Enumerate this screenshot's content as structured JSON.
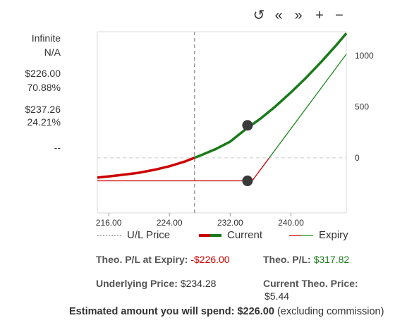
{
  "toolbar": {
    "reset_icon": "↺",
    "prev_icon": "«",
    "next_icon": "»",
    "zoom_in_icon": "+",
    "zoom_out_icon": "−"
  },
  "stats": {
    "max_profit": "Infinite",
    "max_profit_pct": "N/A",
    "max_loss": "$226.00",
    "max_loss_pct": "70.88%",
    "breakeven": "$237.26",
    "breakeven_pct": "24.21%",
    "other": "--"
  },
  "legend": {
    "ul_price": "U/L Price",
    "current": "Current",
    "expiry": "Expiry"
  },
  "colors": {
    "current_green": "#1a7a1a",
    "current_red": "#cc0000",
    "expiry_green": "#1f8a1f",
    "expiry_red": "#cc0000",
    "ul_line": "#888888",
    "point": "#3a3a3a"
  },
  "summary": {
    "theo_pl_expiry_label": "Theo. P/L at Expiry:",
    "theo_pl_expiry_value": "-$226.00",
    "theo_pl_label": "Theo. P/L:",
    "theo_pl_value": "$317.82",
    "underlying_label": "Underlying Price:",
    "underlying_value": "$234.28",
    "current_theo_label": "Current Theo. Price:",
    "current_theo_value": "$5.44"
  },
  "footer": {
    "prefix": "Estimated amount you will spend:",
    "amount": "$226.00",
    "suffix": "(excluding commission)"
  },
  "chart_data": {
    "type": "line",
    "xlim": [
      214.5,
      247.3
    ],
    "ylim": [
      -540,
      1235
    ],
    "x_ticks": [
      "216.00",
      "224.00",
      "232.00",
      "240.00"
    ],
    "x_tick_values": [
      216,
      224,
      232,
      240
    ],
    "y_ticks": [
      "1000",
      "500",
      "0"
    ],
    "y_tick_values": [
      1000,
      500,
      0
    ],
    "ul_price": 227.3,
    "strike": 234.89,
    "premium": 226,
    "current_point": {
      "x": 234.28,
      "y": 317.82
    },
    "expiry_point": {
      "x": 234.28,
      "y": -226
    },
    "series": [
      {
        "name": "Current",
        "x": [
          214.5,
          216,
          218,
          220,
          222,
          224,
          226,
          227.3,
          228,
          230,
          232,
          234,
          236,
          238,
          240,
          242,
          244,
          246,
          247.3
        ],
        "values": [
          -194,
          -182,
          -166,
          -146,
          -118,
          -83,
          -37,
          0,
          20,
          82,
          158,
          278,
          384,
          506,
          640,
          785,
          940,
          1105,
          1219
        ]
      },
      {
        "name": "Expiry",
        "x": [
          214.5,
          234.89,
          247.3
        ],
        "values": [
          -226,
          -226,
          1015
        ]
      }
    ]
  }
}
